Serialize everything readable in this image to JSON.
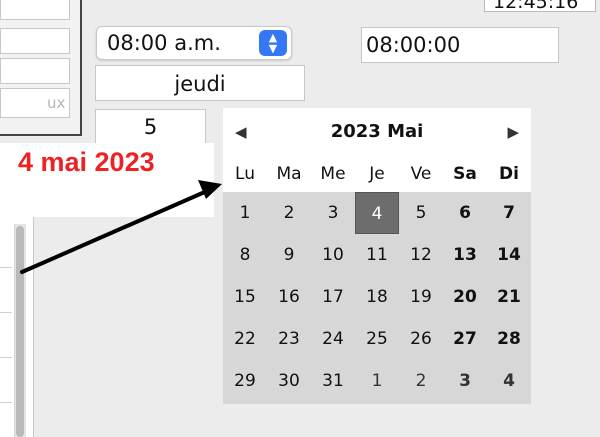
{
  "left_panel": {
    "field4_text": "ux"
  },
  "clock": {
    "text": "12:45:16"
  },
  "time_select": {
    "value": "08:00 a.m.",
    "arrow_up": "▲",
    "arrow_down": "▼"
  },
  "time_field": {
    "value": "08:00:00"
  },
  "weekday_field": {
    "value": "jeudi"
  },
  "daynum_field": {
    "value": "5"
  },
  "annotation": {
    "text": "4 mai 2023",
    "color": "#ee2222"
  },
  "calendar": {
    "title": "2023 Mai",
    "prev": "◀",
    "next": "▶",
    "weekdays": [
      "Lu",
      "Ma",
      "Me",
      "Je",
      "Ve",
      "Sa",
      "Di"
    ],
    "weeks": [
      [
        "1",
        "2",
        "3",
        "4",
        "5",
        "6",
        "7"
      ],
      [
        "8",
        "9",
        "10",
        "11",
        "12",
        "13",
        "14"
      ],
      [
        "15",
        "16",
        "17",
        "18",
        "19",
        "20",
        "21"
      ],
      [
        "22",
        "23",
        "24",
        "25",
        "26",
        "27",
        "28"
      ],
      [
        "29",
        "30",
        "31",
        "1",
        "2",
        "3",
        "4"
      ]
    ],
    "selected_day": "4",
    "selected_color": "#6d6d6d"
  }
}
